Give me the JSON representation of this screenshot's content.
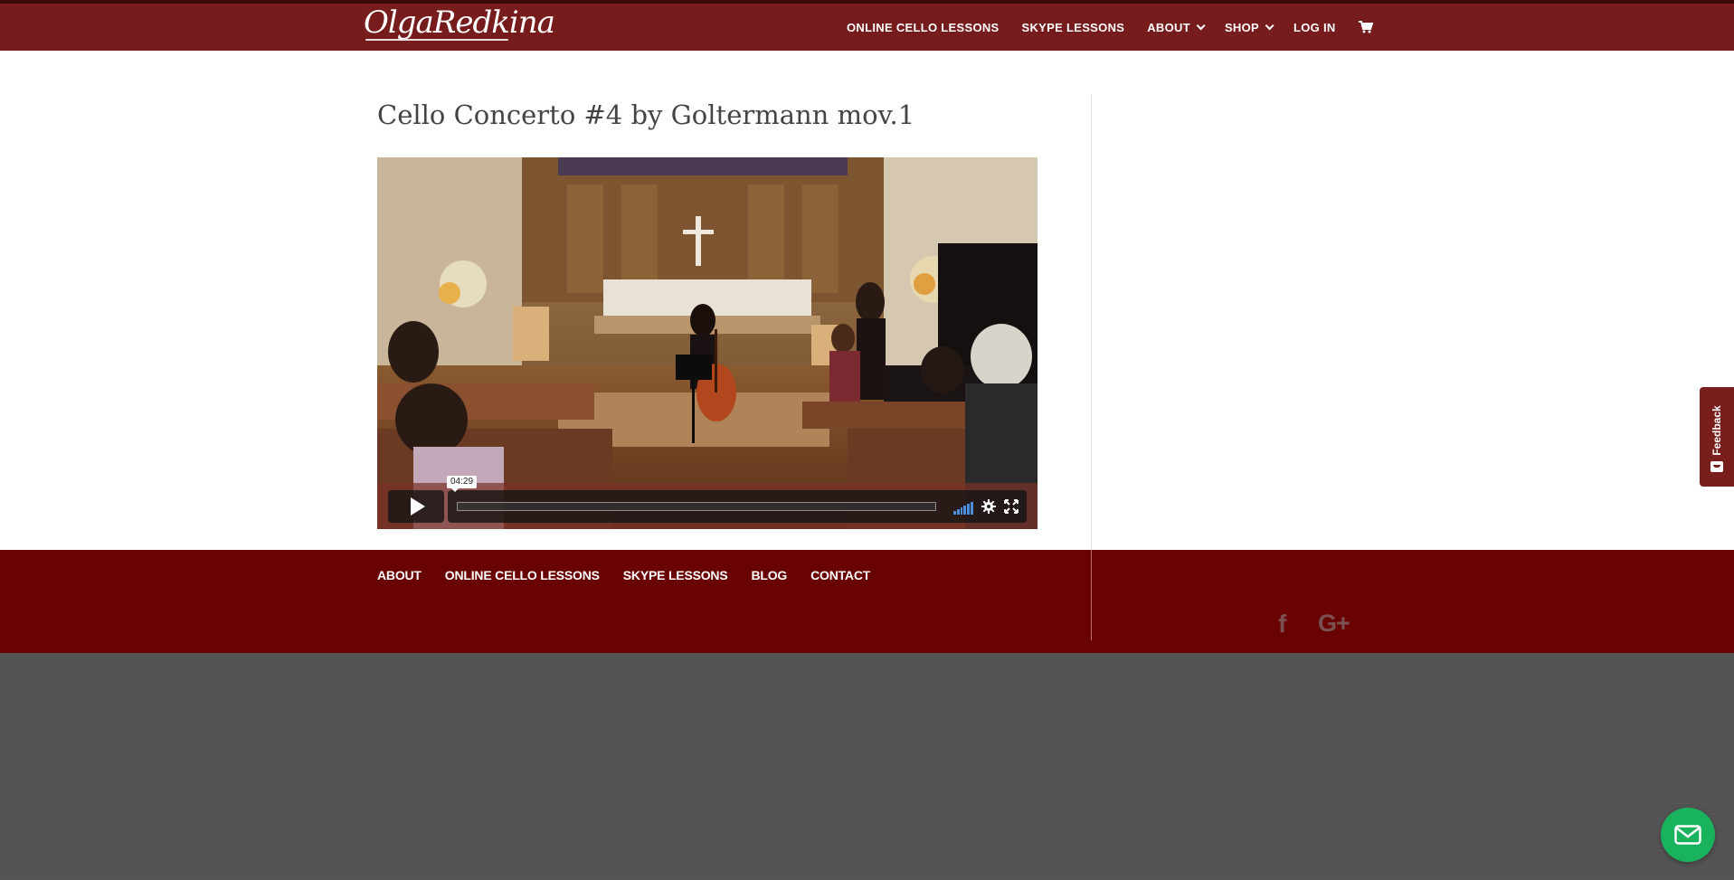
{
  "header": {
    "logo_text": "OlgaRedkina",
    "nav": [
      {
        "label": "ONLINE CELLO LESSONS",
        "dropdown": false
      },
      {
        "label": "SKYPE LESSONS",
        "dropdown": false
      },
      {
        "label": "ABOUT",
        "dropdown": true
      },
      {
        "label": "SHOP",
        "dropdown": true
      },
      {
        "label": "LOG IN",
        "dropdown": false
      }
    ],
    "cart_icon": "shopping-cart-icon"
  },
  "post": {
    "title": "Cello Concerto #4 by Goltermann mov.1"
  },
  "video": {
    "hover_time": "04:29",
    "progress_fraction": 0.0,
    "play_icon": "play-icon",
    "volume_icon": "volume-bars-icon",
    "settings_icon": "gear-icon",
    "fullscreen_icon": "fullscreen-icon"
  },
  "footer": {
    "links": [
      "ABOUT",
      "ONLINE CELLO LESSONS",
      "SKYPE LESSONS",
      "BLOG",
      "CONTACT"
    ],
    "social": [
      {
        "name": "facebook-icon",
        "glyph": "f"
      },
      {
        "name": "google-plus-icon",
        "glyph": "G+"
      }
    ]
  },
  "feedback": {
    "label": "Feedback"
  },
  "chat": {
    "icon": "mail-icon"
  },
  "colors": {
    "header_bg": "#771c1c",
    "footer_bg": "#690202",
    "bottom_bg": "#535353",
    "chat_bg": "#19b35e",
    "volume_accent": "#4a8fdc"
  }
}
